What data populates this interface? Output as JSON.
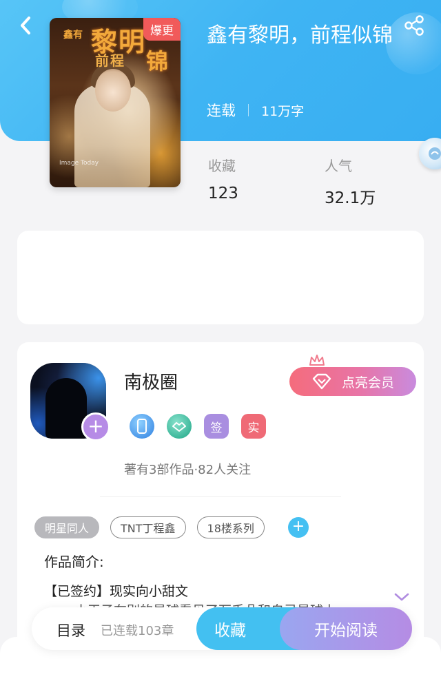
{
  "header": {
    "hot_badge": "爆更",
    "cover": {
      "title_main": "黎明",
      "title_small": "鑫有",
      "title_sub": "前程",
      "title_end": "锦",
      "caption": "Image Today"
    }
  },
  "book": {
    "title": "鑫有黎明，前程似锦",
    "status": "连载",
    "word_count": "11万字"
  },
  "stats": {
    "favorites_label": "收藏",
    "favorites_value": "123",
    "popularity_label": "人气",
    "popularity_value": "32.1万"
  },
  "author": {
    "name": "南极圈",
    "vip_label": "点亮会员",
    "badges": [
      "签",
      "实"
    ],
    "summary": "著有3部作品·82人关注"
  },
  "tags": [
    "明星同人",
    "TNT丁程鑫",
    "18楼系列"
  ],
  "intro": {
    "label": "作品简介:",
    "line1": "【已签约】现实向小甜文",
    "line2": "小王子在别的星球看见了万千朵和自己星球上"
  },
  "bottom_bar": {
    "toc_label": "目录",
    "chapters": "已连载103章",
    "collect_label": "收藏",
    "read_label": "开始阅读"
  },
  "colors": {
    "header_blue": "#3fb4f3",
    "collect_blue": "#43c0f1",
    "hot_red": "#f15a5a",
    "vip_pink": "#f56c7c",
    "read_purple": "#b58ce4"
  }
}
